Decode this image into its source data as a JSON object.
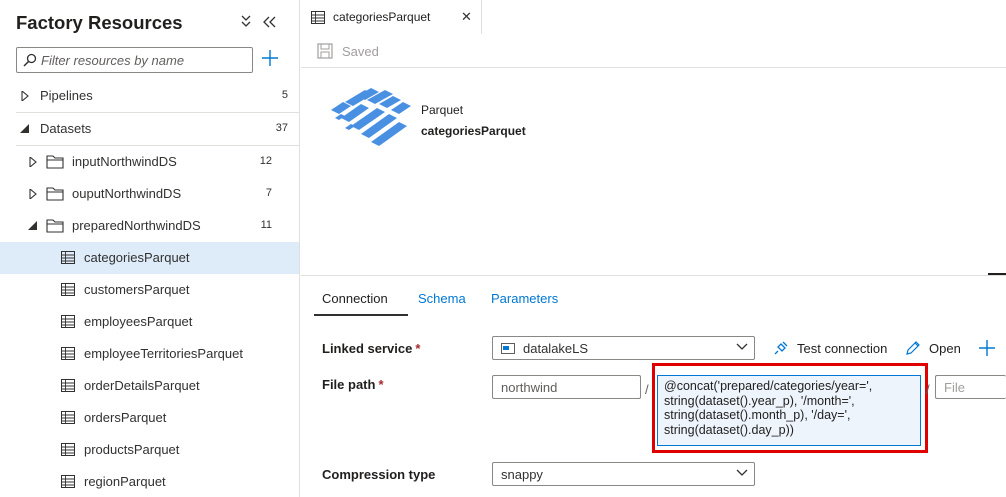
{
  "sidebar": {
    "title": "Factory Resources",
    "filter_placeholder": "Filter resources by name",
    "groups": [
      {
        "label": "Pipelines",
        "count": "5"
      },
      {
        "label": "Datasets",
        "count": "37"
      }
    ],
    "folders": [
      {
        "label": "inputNorthwindDS",
        "count": "12"
      },
      {
        "label": "ouputNorthwindDS",
        "count": "7"
      },
      {
        "label": "preparedNorthwindDS",
        "count": "11"
      }
    ],
    "datasets": [
      "categoriesParquet",
      "customersParquet",
      "employeesParquet",
      "employeeTerritoriesParquet",
      "orderDetailsParquet",
      "ordersParquet",
      "productsParquet",
      "regionParquet"
    ]
  },
  "tab": {
    "label": "categoriesParquet",
    "close": "✕"
  },
  "toolbar": {
    "saved_label": "Saved"
  },
  "overview": {
    "type": "Parquet",
    "name": "categoriesParquet"
  },
  "config_tabs": [
    "Connection",
    "Schema",
    "Parameters"
  ],
  "form": {
    "linked_service_label": "Linked service",
    "linked_service_value": "datalakeLS",
    "test_connection": "Test connection",
    "open": "Open",
    "file_path_label": "File path",
    "container_value": "northwind",
    "expression_lines": [
      "@concat('prepared/categories/year=',",
      "string(dataset().year_p), '/month=',",
      "string(dataset().month_p), '/day=',",
      "string(dataset().day_p))"
    ],
    "file_placeholder": "File",
    "compression_label": "Compression type",
    "compression_value": "snappy",
    "required_marker": "*",
    "slash": "/"
  }
}
